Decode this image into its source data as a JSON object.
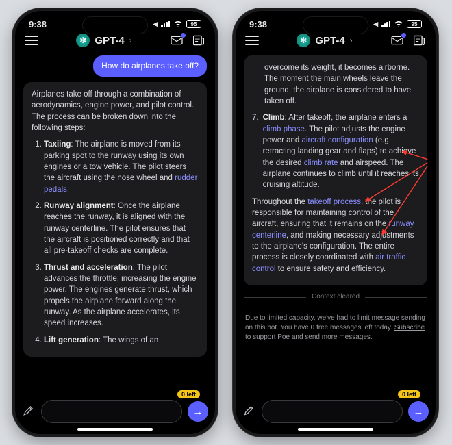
{
  "status": {
    "time": "9:38",
    "battery": "95"
  },
  "header": {
    "title": "GPT-4",
    "icon": "openai-icon",
    "inbox_icon": "mail-icon",
    "news_icon": "newspaper-icon"
  },
  "phone1": {
    "user_message": "How do airplanes take off?",
    "bot_intro": "Airplanes take off through a combination of aerodynamics, engine power, and pilot control. The process can be broken down into the following steps:",
    "steps": [
      {
        "title": "Taxiing",
        "body_pre": ": The airplane is moved from its parking spot to the runway using its own engines or a tow vehicle. The pilot steers the aircraft using the nose wheel and ",
        "link": "rudder pedals",
        "body_post": "."
      },
      {
        "title": "Runway alignment",
        "body_pre": ": Once the airplane reaches the runway, it is aligned with the runway centerline. The pilot ensures that the aircraft is positioned correctly and that all pre-takeoff checks are complete.",
        "link": "",
        "body_post": ""
      },
      {
        "title": "Thrust and acceleration",
        "body_pre": ": The pilot advances the throttle, increasing the engine power. The engines generate thrust, which propels the airplane forward along the runway. As the airplane accelerates, its speed increases.",
        "link": "",
        "body_post": ""
      },
      {
        "title": "Lift generation",
        "body_pre": ": The wings of an",
        "link": "",
        "body_post": ""
      }
    ]
  },
  "phone2": {
    "bot_top": "overcome its weight, it becomes airborne. The moment the main wheels leave the ground, the airplane is considered to have taken off.",
    "step7": {
      "num": "7.",
      "title": "Climb",
      "seg1": ": After takeoff, the airplane enters a ",
      "link1": "climb phase",
      "seg2": ". The pilot adjusts the engine power and ",
      "link2": "aircraft configuration",
      "seg3": " (e.g. retracting landing gear and flaps) to achieve the desired ",
      "link3": "climb rate",
      "seg4": " and airspeed. The airplane continues to climb until it reaches its cruising altitude."
    },
    "closing": {
      "seg1": "Throughout the ",
      "link1": "takeoff process",
      "seg2": ", the pilot is responsible for maintaining control of the aircraft, ensuring that it remains on the ",
      "link2": "runway centerline",
      "seg3": ", and making necessary adjustments to the airplane's configuration. The entire process is closely coordinated with ",
      "link3": "air traffic control",
      "seg4": " to ensure safety and efficiency."
    },
    "divider": "Context cleared",
    "notice_pre": "Due to limited capacity, we've had to limit message sending on this bot. You have 0 free messages left today. ",
    "notice_link": "Subscribe",
    "notice_post": " to support Poe and send more messages."
  },
  "input": {
    "badge": "0 left",
    "send_icon": "arrow-right-icon",
    "brush_icon": "brush-icon"
  }
}
